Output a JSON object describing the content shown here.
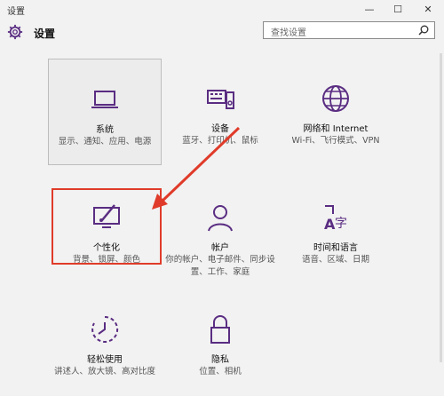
{
  "window": {
    "title": "设置",
    "minimize": "—",
    "maximize": "☐",
    "close": "✕"
  },
  "header": {
    "title": "设置",
    "search_placeholder": "查找设置"
  },
  "tiles": [
    {
      "name": "系统",
      "desc": "显示、通知、应用、电源",
      "icon": "laptop-icon"
    },
    {
      "name": "设备",
      "desc": "蓝牙、打印机、鼠标",
      "icon": "keyboard-speaker-icon"
    },
    {
      "name": "网络和 Internet",
      "desc": "Wi-Fi、飞行模式、VPN",
      "icon": "globe-icon"
    },
    {
      "name": "个性化",
      "desc": "背景、锁屏、颜色",
      "icon": "paint-monitor-icon"
    },
    {
      "name": "帐户",
      "desc": "你的帐户、电子邮件、同步设置、工作、家庭",
      "icon": "person-icon"
    },
    {
      "name": "时间和语言",
      "desc": "语音、区域、日期",
      "icon": "time-language-icon"
    },
    {
      "name": "轻松使用",
      "desc": "讲述人、放大镜、高对比度",
      "icon": "ease-of-access-icon"
    },
    {
      "name": "隐私",
      "desc": "位置、相机",
      "icon": "lock-icon"
    }
  ],
  "colors": {
    "accent": "#5a2d82",
    "annotation": "#e03b2a",
    "background": "#f2f2f2"
  }
}
